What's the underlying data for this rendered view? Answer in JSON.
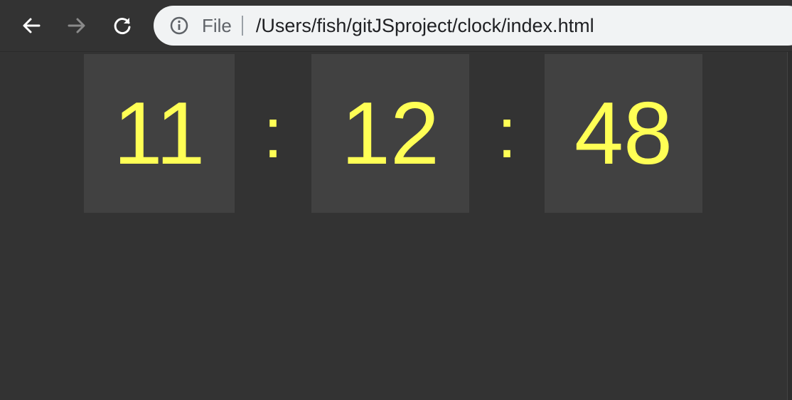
{
  "browser": {
    "address_bar": {
      "scheme_label": "File",
      "url": "/Users/fish/gitJSproject/clock/index.html"
    },
    "icons": {
      "back": "arrow-left-icon",
      "forward": "arrow-right-icon",
      "reload": "reload-icon",
      "info": "info-circle-icon"
    }
  },
  "clock": {
    "hours": "11",
    "separator_1": ":",
    "minutes": "12",
    "separator_2": ":",
    "seconds": "48"
  },
  "colors": {
    "page_background": "#333333",
    "digit_box": "#414141",
    "digit_text": "#ffff55",
    "address_bar": "#f1f3f4"
  }
}
